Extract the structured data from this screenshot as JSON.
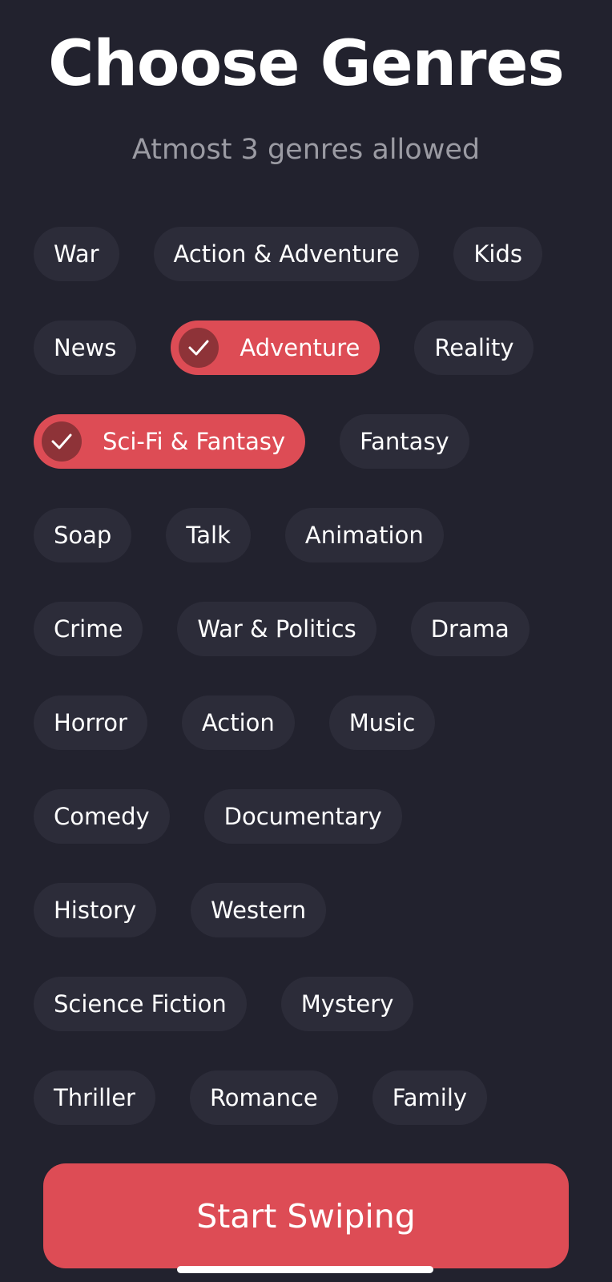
{
  "header": {
    "title": "Choose Genres",
    "subtitle": "Atmost 3 genres allowed"
  },
  "genre_rows": [
    [
      {
        "label": "War",
        "selected": false
      },
      {
        "label": "Action & Adventure",
        "selected": false
      },
      {
        "label": "Kids",
        "selected": false
      }
    ],
    [
      {
        "label": "News",
        "selected": false
      },
      {
        "label": "Adventure",
        "selected": true
      },
      {
        "label": "Reality",
        "selected": false
      }
    ],
    [
      {
        "label": "Sci-Fi & Fantasy",
        "selected": true
      },
      {
        "label": "Fantasy",
        "selected": false
      }
    ],
    [
      {
        "label": "Soap",
        "selected": false
      },
      {
        "label": "Talk",
        "selected": false
      },
      {
        "label": "Animation",
        "selected": false
      }
    ],
    [
      {
        "label": "Crime",
        "selected": false
      },
      {
        "label": "War & Politics",
        "selected": false
      },
      {
        "label": "Drama",
        "selected": false
      }
    ],
    [
      {
        "label": "Horror",
        "selected": false
      },
      {
        "label": "Action",
        "selected": false
      },
      {
        "label": "Music",
        "selected": false
      }
    ],
    [
      {
        "label": "Comedy",
        "selected": false
      },
      {
        "label": "Documentary",
        "selected": false
      }
    ],
    [
      {
        "label": "History",
        "selected": false
      },
      {
        "label": "Western",
        "selected": false
      }
    ],
    [
      {
        "label": "Science Fiction",
        "selected": false
      },
      {
        "label": "Mystery",
        "selected": false
      }
    ],
    [
      {
        "label": "Thriller",
        "selected": false
      },
      {
        "label": "Romance",
        "selected": false
      },
      {
        "label": "Family",
        "selected": false
      }
    ]
  ],
  "footer": {
    "start_label": "Start Swiping"
  },
  "icons": {
    "selected": "check-icon"
  },
  "colors": {
    "background": "#22222e",
    "chip": "#2c2c39",
    "accent": "#dd4c55",
    "check_badge": "#8e3338",
    "subtitle": "#9b9ba3"
  }
}
